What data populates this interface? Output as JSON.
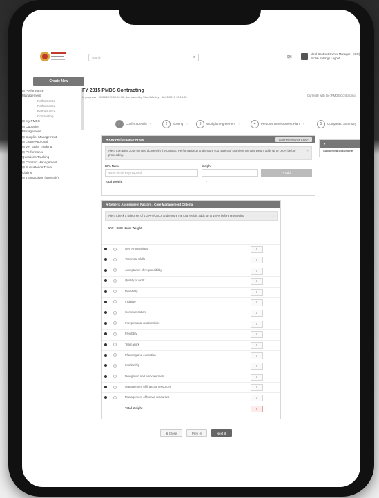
{
  "app": {
    "search_placeholder": "search",
    "user_lines": [
      "Ideal Contract Owner Manager - (ICO)",
      "Profile  Settings  Logout"
    ]
  },
  "sidebar": {
    "create_label": "Create New",
    "items": [
      "⊞ Performance",
      "Management",
      "Performance",
      "Performance",
      "Performance",
      "Contracting",
      "⊞ My PMDS",
      "⊞ Quotation",
      "Management",
      "⊞ Supplier Management",
      "⊞ Leave Approval",
      "⊞ Vet Tasks Tracking",
      "⊞ Performance",
      "Questions Tracking",
      "⊞ Contract Management",
      "⊞ Subsistence Travel",
      "Claims",
      "⊞ Transactions (anomaly)"
    ]
  },
  "page": {
    "title": "FY 2015 PMDS Contracting",
    "meta": "In progress · 01/06/2015 00:00:00 , last saved by Short Mosley · 12/05/2015 10:16:05",
    "currently_with": "Currently with the: PMDS Contracting"
  },
  "steps": [
    "Confirm Details",
    "Scoring",
    "Workplan Agreement",
    "Personal Development Plan",
    "Completed Summary"
  ],
  "kpa": {
    "header": "Key Performance Areas",
    "button": "Add Performance KPA +",
    "alert": "Alert: Complete 20 to or none above with the Contract Performance 3) and ensure you have 5 of to ahieve the total weight adds up to 100% before proceeding.",
    "name_label": "KPA Name",
    "weight_label": "Weight",
    "name_placeholder": "Name of the Key required",
    "add_label": "+ Add",
    "total_label": "Total Weight"
  },
  "side_panel": {
    "header": "",
    "label": "Supporting Documents"
  },
  "gaf": {
    "header": "Generic Assessment Factors / Core Management Criteria",
    "alert": "Alert: Check a select set of 4 GAFs/CMCs and ensure the total weight adds up to 100% before proceeding",
    "col_header": "GAF / CMC Name  Weight",
    "rows": [
      "Gen Proceedings",
      "Technical Skills",
      "Acceptance of responsibility",
      "Quality of work",
      "Reliability",
      "Initiative",
      "Communication",
      "Interpersonal relationships",
      "Flexibility",
      "Team work",
      "Planning and execution",
      "Leadership",
      "Delegation and empowerment",
      "Management of financial resources",
      "Management of human resources"
    ],
    "weights": [
      "0",
      "0",
      "0",
      "0",
      "0",
      "0",
      "0",
      "0",
      "0",
      "0",
      "0",
      "0",
      "0",
      "0",
      "0"
    ],
    "total_label": "Total Weight",
    "total_value": "0"
  },
  "footer": {
    "close": "Close",
    "prev": "Prev",
    "next": "Next"
  }
}
